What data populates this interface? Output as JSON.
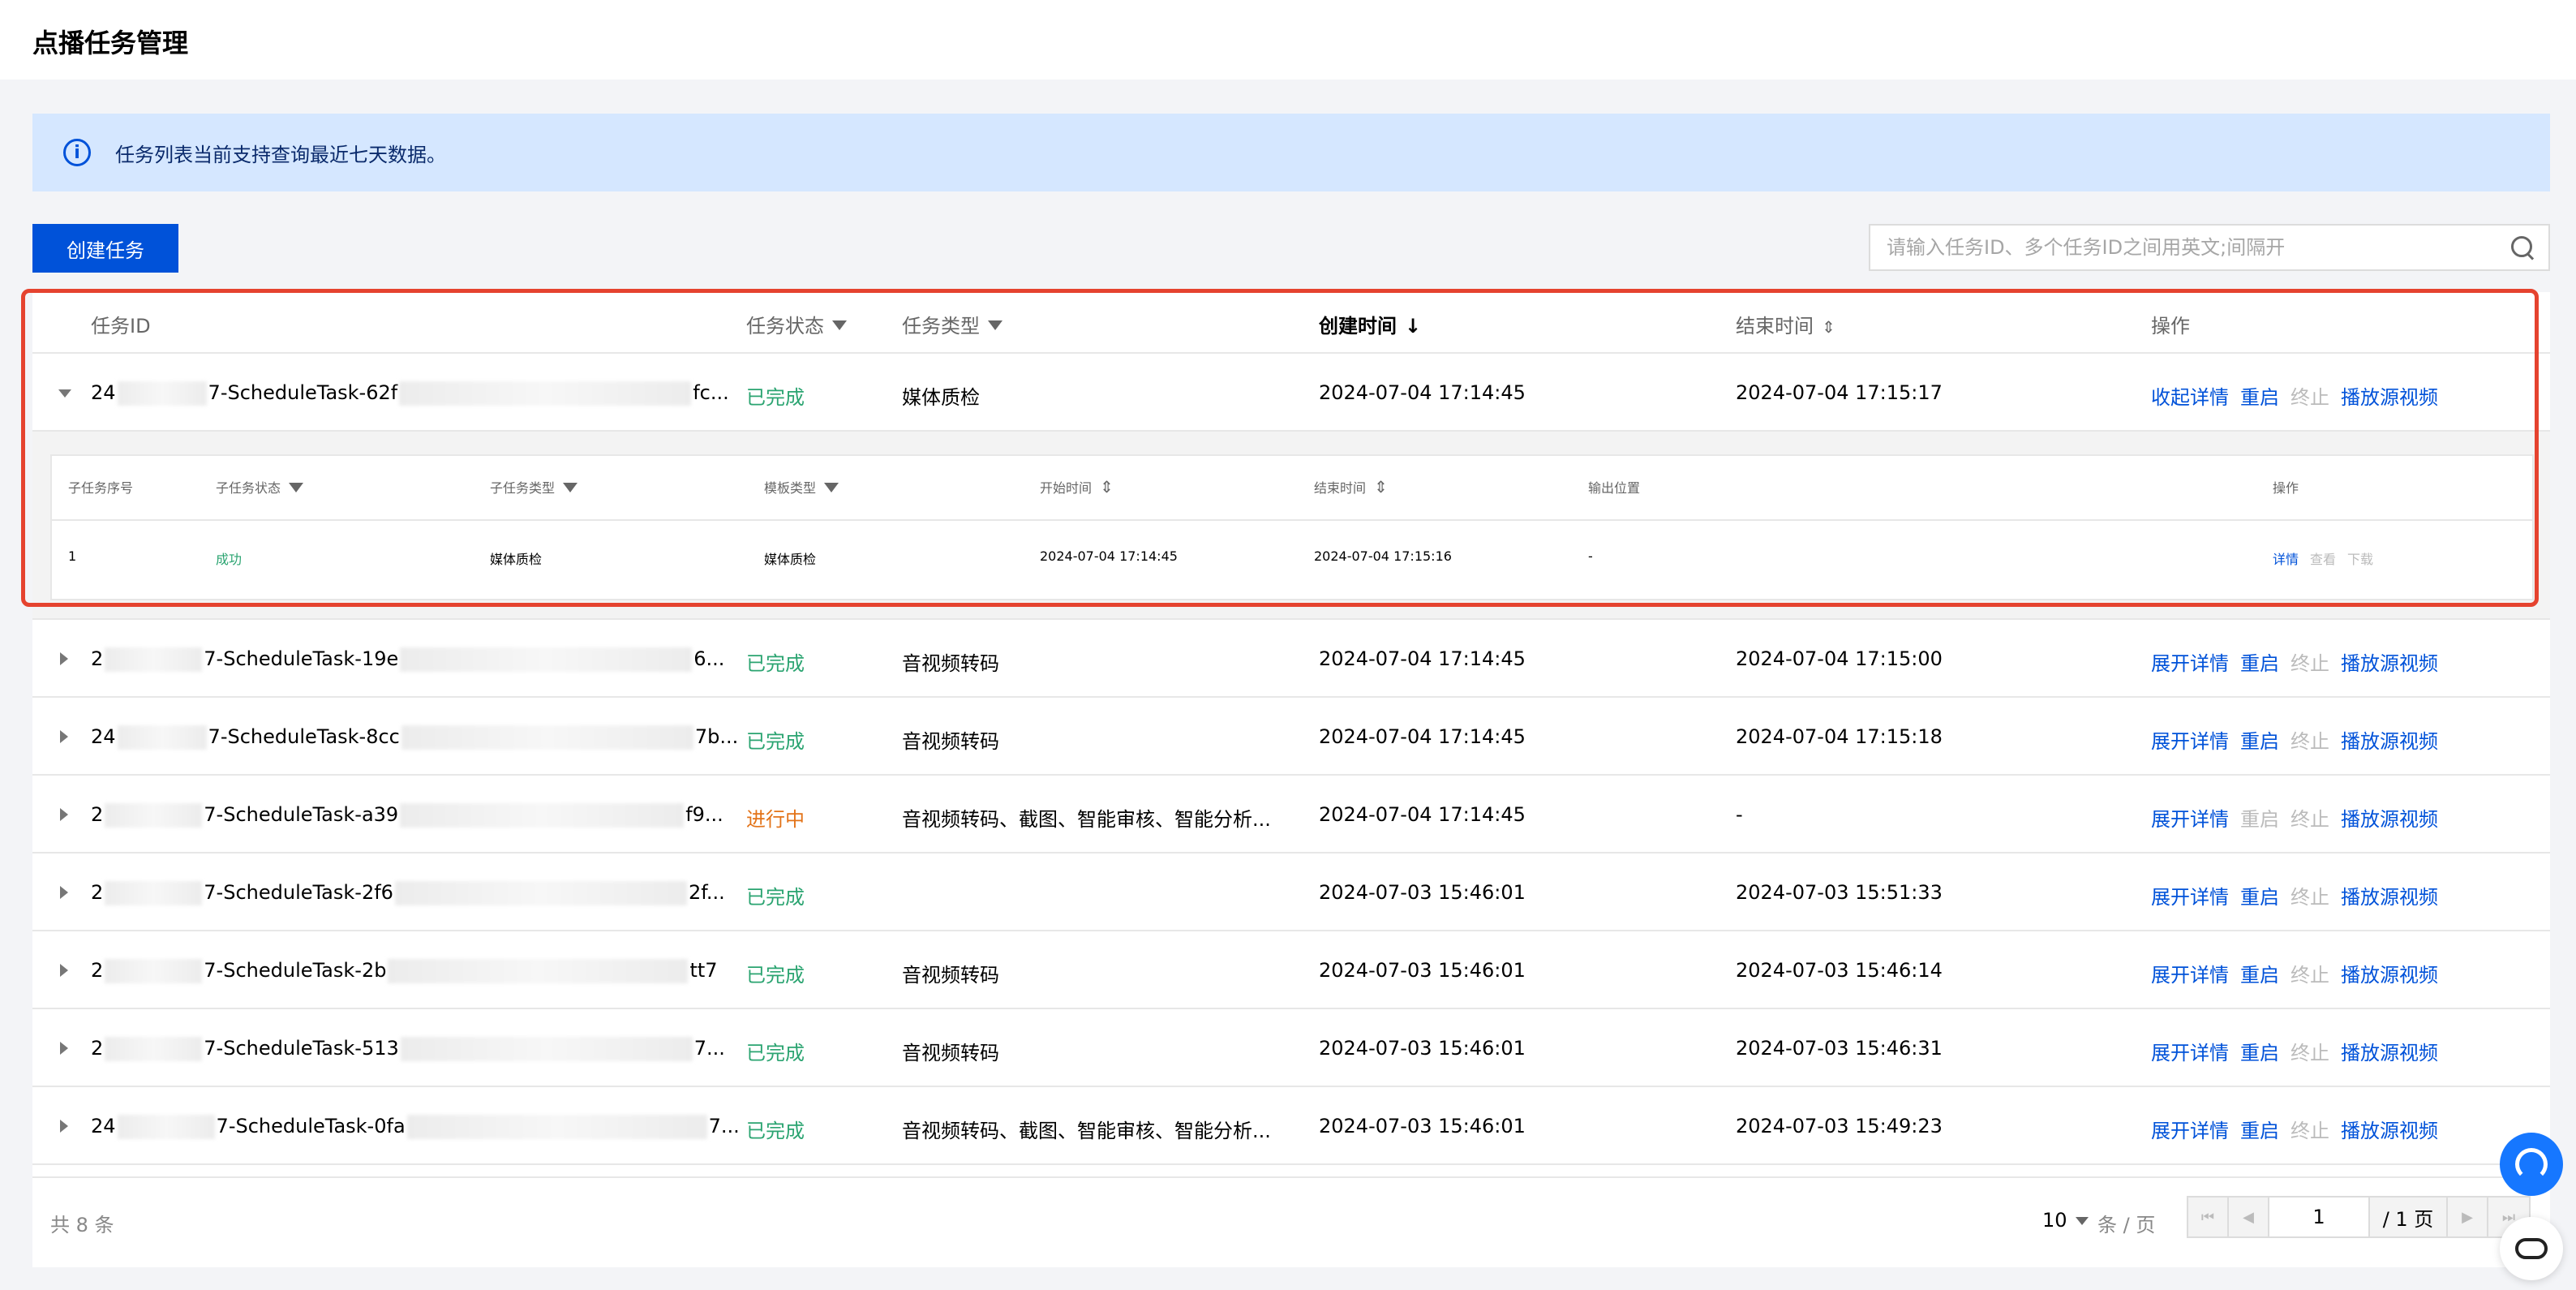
{
  "page": {
    "title": "点播任务管理"
  },
  "notice": {
    "text": "任务列表当前支持查询最近七天数据。"
  },
  "toolbar": {
    "create_label": "创建任务",
    "search_placeholder": "请输入任务ID、多个任务ID之间用英文;间隔开"
  },
  "table": {
    "headers": {
      "task_id": "任务ID",
      "status": "任务状态",
      "type": "任务类型",
      "created": "创建时间",
      "ended": "结束时间",
      "actions": "操作"
    },
    "rows": [
      {
        "id_a": "24",
        "id_b": "7-ScheduleTask-62f",
        "id_c": "fc...",
        "status": "已完成",
        "type": "媒体质检",
        "created": "2024-07-04 17:14:45",
        "ended": "2024-07-04 17:15:17",
        "detail": "收起详情",
        "restart": "重启",
        "stop": "终止",
        "play": "播放源视频"
      },
      {
        "id_a": "2",
        "id_b": "7-ScheduleTask-19e",
        "id_c": "6...",
        "status": "已完成",
        "type": "音视频转码",
        "created": "2024-07-04 17:14:45",
        "ended": "2024-07-04 17:15:00",
        "detail": "展开详情",
        "restart": "重启",
        "stop": "终止",
        "play": "播放源视频"
      },
      {
        "id_a": "24",
        "id_b": "7-ScheduleTask-8cc",
        "id_c": "7b...",
        "status": "已完成",
        "type": "音视频转码",
        "created": "2024-07-04 17:14:45",
        "ended": "2024-07-04 17:15:18",
        "detail": "展开详情",
        "restart": "重启",
        "stop": "终止",
        "play": "播放源视频"
      },
      {
        "id_a": "2",
        "id_b": "7-ScheduleTask-a39",
        "id_c": "f9...",
        "status": "进行中",
        "type": "音视频转码、截图、智能审核、智能分析...",
        "created": "2024-07-04 17:14:45",
        "ended": "-",
        "detail": "展开详情",
        "restart": "重启",
        "stop": "终止",
        "play": "播放源视频"
      },
      {
        "id_a": "2",
        "id_b": "7-ScheduleTask-2f6",
        "id_c": "2f...",
        "status": "已完成",
        "type": "",
        "created": "2024-07-03 15:46:01",
        "ended": "2024-07-03 15:51:33",
        "detail": "展开详情",
        "restart": "重启",
        "stop": "终止",
        "play": "播放源视频"
      },
      {
        "id_a": "2",
        "id_b": "7-ScheduleTask-2b",
        "id_c": "tt7",
        "status": "已完成",
        "type": "音视频转码",
        "created": "2024-07-03 15:46:01",
        "ended": "2024-07-03 15:46:14",
        "detail": "展开详情",
        "restart": "重启",
        "stop": "终止",
        "play": "播放源视频"
      },
      {
        "id_a": "2",
        "id_b": "7-ScheduleTask-513",
        "id_c": "7...",
        "status": "已完成",
        "type": "音视频转码",
        "created": "2024-07-03 15:46:01",
        "ended": "2024-07-03 15:46:31",
        "detail": "展开详情",
        "restart": "重启",
        "stop": "终止",
        "play": "播放源视频"
      },
      {
        "id_a": "24",
        "id_b": "7-ScheduleTask-0fa",
        "id_c": "7...",
        "status": "已完成",
        "type": "音视频转码、截图、智能审核、智能分析...",
        "created": "2024-07-03 15:46:01",
        "ended": "2024-07-03 15:49:23",
        "detail": "展开详情",
        "restart": "重启",
        "stop": "终止",
        "play": "播放源视频"
      }
    ]
  },
  "subtable": {
    "headers": {
      "seq": "子任务序号",
      "status": "子任务状态",
      "type": "子任务类型",
      "template": "模板类型",
      "start": "开始时间",
      "end": "结束时间",
      "output": "输出位置",
      "actions": "操作"
    },
    "row": {
      "seq": "1",
      "status": "成功",
      "type": "媒体质检",
      "template": "媒体质检",
      "start": "2024-07-04 17:14:45",
      "end": "2024-07-04 17:15:16",
      "output": "-",
      "detail": "详情",
      "view": "查看",
      "download": "下载"
    }
  },
  "footer": {
    "total": "共 8 条",
    "page_size": "10",
    "per_page": "条 / 页",
    "current_page": "1",
    "total_pages": "/ 1 页"
  },
  "colors": {
    "primary": "#0052d9",
    "success": "#2ba471",
    "warning": "#e37318",
    "highlight": "#e5432f"
  }
}
